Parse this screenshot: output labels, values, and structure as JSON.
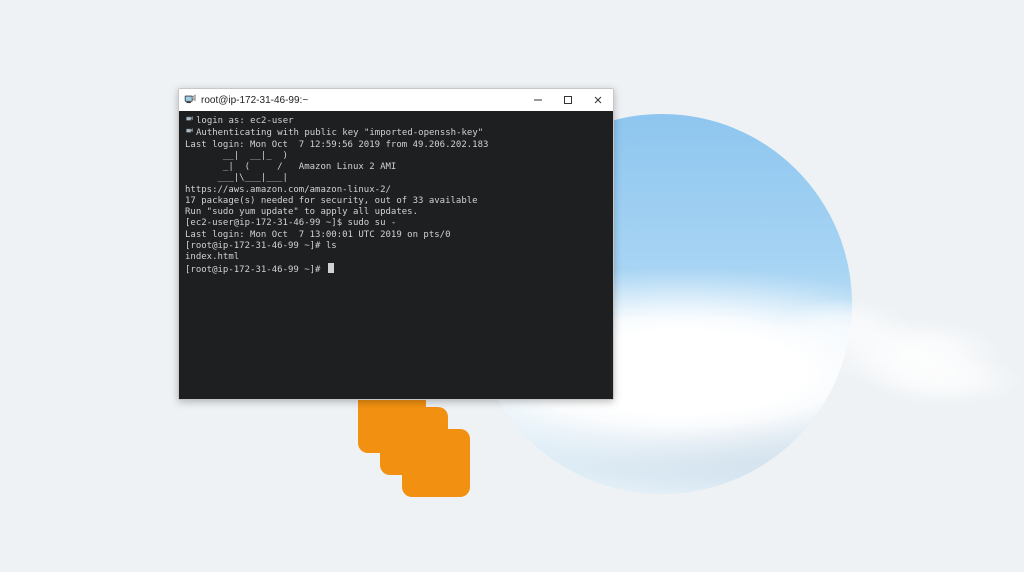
{
  "window": {
    "title": "root@ip-172-31-46-99:~"
  },
  "terminal": {
    "lines": [
      "login as: ec2-user",
      "Authenticating with public key \"imported-openssh-key\"",
      "Last login: Mon Oct  7 12:59:56 2019 from 49.206.202.183",
      "",
      "       __|  __|_  )",
      "       _|  (     /   Amazon Linux 2 AMI",
      "      ___|\\___|___|",
      "",
      "https://aws.amazon.com/amazon-linux-2/",
      "17 package(s) needed for security, out of 33 available",
      "Run \"sudo yum update\" to apply all updates.",
      "[ec2-user@ip-172-31-46-99 ~]$ sudo su -",
      "Last login: Mon Oct  7 13:00:01 UTC 2019 on pts/0",
      "[root@ip-172-31-46-99 ~]# ls",
      "index.html",
      "[root@ip-172-31-46-99 ~]# "
    ]
  },
  "colors": {
    "ec2_orange": "#f29111",
    "term_bg": "#1d1f21",
    "term_fg": "#cfd2d4"
  }
}
